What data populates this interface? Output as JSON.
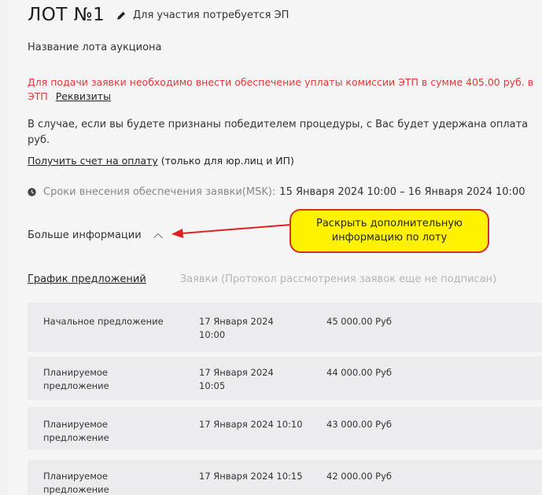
{
  "lot": {
    "title": "ЛОТ №1",
    "eds_note": "Для участия потребуется ЭП",
    "name": "Название лота аукциона"
  },
  "deposit": {
    "text_line1": "Для подачи заявки необходимо внести обеспечение уплаты комиссии ЭТП в сумме 405.00 руб. в",
    "text_line2": "ЭТП",
    "details_link": "Реквизиты"
  },
  "winner_notice": {
    "line1": "В случае, если вы будете признаны победителем процедуры, с Вас будет удержана оплата",
    "line2": "руб."
  },
  "invoice": {
    "link": "Получить счет на оплату",
    "note": " (только для юр.лиц и ИП)"
  },
  "deadline": {
    "label": "Сроки внесения обеспечения заявки(MSK):",
    "dates": "15 Января 2024 10:00 – 16 Января 2024 10:00"
  },
  "more_info": {
    "label": "Больше информации"
  },
  "tabs": [
    {
      "label": "График предложений",
      "active": true
    },
    {
      "label": "Заявки (Протокол рассмотрения заявок еще не подписан)",
      "active": false
    }
  ],
  "schedule": [
    {
      "type": "Начальное предложение",
      "date": "17 Января 2024 10:00",
      "price": "45 000.00 Руб"
    },
    {
      "type": "Планируемое предложение",
      "date": "17 Января 2024 10:05",
      "price": "44 000.00 Руб"
    },
    {
      "type": "Планируемое предложение",
      "date": "17 Января 2024 10:10",
      "price": "43 000.00 Руб"
    },
    {
      "type": "Планируемое предложение",
      "date": "17 Января 2024 10:15",
      "price": "42 000.00 Руб"
    }
  ],
  "callout": {
    "text": "Раскрыть дополнительную информацию по лоту"
  },
  "colors": {
    "warning_red": "#e53935",
    "callout_fill": "#fff200",
    "callout_border": "#d32f2f"
  }
}
